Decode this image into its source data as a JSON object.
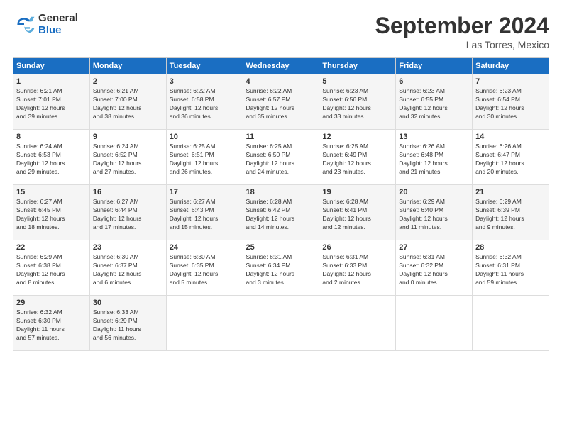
{
  "logo": {
    "general": "General",
    "blue": "Blue"
  },
  "header": {
    "title": "September 2024",
    "location": "Las Torres, Mexico"
  },
  "weekdays": [
    "Sunday",
    "Monday",
    "Tuesday",
    "Wednesday",
    "Thursday",
    "Friday",
    "Saturday"
  ],
  "weeks": [
    [
      {
        "day": "1",
        "lines": [
          "Sunrise: 6:21 AM",
          "Sunset: 7:01 PM",
          "Daylight: 12 hours",
          "and 39 minutes."
        ]
      },
      {
        "day": "2",
        "lines": [
          "Sunrise: 6:21 AM",
          "Sunset: 7:00 PM",
          "Daylight: 12 hours",
          "and 38 minutes."
        ]
      },
      {
        "day": "3",
        "lines": [
          "Sunrise: 6:22 AM",
          "Sunset: 6:58 PM",
          "Daylight: 12 hours",
          "and 36 minutes."
        ]
      },
      {
        "day": "4",
        "lines": [
          "Sunrise: 6:22 AM",
          "Sunset: 6:57 PM",
          "Daylight: 12 hours",
          "and 35 minutes."
        ]
      },
      {
        "day": "5",
        "lines": [
          "Sunrise: 6:23 AM",
          "Sunset: 6:56 PM",
          "Daylight: 12 hours",
          "and 33 minutes."
        ]
      },
      {
        "day": "6",
        "lines": [
          "Sunrise: 6:23 AM",
          "Sunset: 6:55 PM",
          "Daylight: 12 hours",
          "and 32 minutes."
        ]
      },
      {
        "day": "7",
        "lines": [
          "Sunrise: 6:23 AM",
          "Sunset: 6:54 PM",
          "Daylight: 12 hours",
          "and 30 minutes."
        ]
      }
    ],
    [
      {
        "day": "8",
        "lines": [
          "Sunrise: 6:24 AM",
          "Sunset: 6:53 PM",
          "Daylight: 12 hours",
          "and 29 minutes."
        ]
      },
      {
        "day": "9",
        "lines": [
          "Sunrise: 6:24 AM",
          "Sunset: 6:52 PM",
          "Daylight: 12 hours",
          "and 27 minutes."
        ]
      },
      {
        "day": "10",
        "lines": [
          "Sunrise: 6:25 AM",
          "Sunset: 6:51 PM",
          "Daylight: 12 hours",
          "and 26 minutes."
        ]
      },
      {
        "day": "11",
        "lines": [
          "Sunrise: 6:25 AM",
          "Sunset: 6:50 PM",
          "Daylight: 12 hours",
          "and 24 minutes."
        ]
      },
      {
        "day": "12",
        "lines": [
          "Sunrise: 6:25 AM",
          "Sunset: 6:49 PM",
          "Daylight: 12 hours",
          "and 23 minutes."
        ]
      },
      {
        "day": "13",
        "lines": [
          "Sunrise: 6:26 AM",
          "Sunset: 6:48 PM",
          "Daylight: 12 hours",
          "and 21 minutes."
        ]
      },
      {
        "day": "14",
        "lines": [
          "Sunrise: 6:26 AM",
          "Sunset: 6:47 PM",
          "Daylight: 12 hours",
          "and 20 minutes."
        ]
      }
    ],
    [
      {
        "day": "15",
        "lines": [
          "Sunrise: 6:27 AM",
          "Sunset: 6:45 PM",
          "Daylight: 12 hours",
          "and 18 minutes."
        ]
      },
      {
        "day": "16",
        "lines": [
          "Sunrise: 6:27 AM",
          "Sunset: 6:44 PM",
          "Daylight: 12 hours",
          "and 17 minutes."
        ]
      },
      {
        "day": "17",
        "lines": [
          "Sunrise: 6:27 AM",
          "Sunset: 6:43 PM",
          "Daylight: 12 hours",
          "and 15 minutes."
        ]
      },
      {
        "day": "18",
        "lines": [
          "Sunrise: 6:28 AM",
          "Sunset: 6:42 PM",
          "Daylight: 12 hours",
          "and 14 minutes."
        ]
      },
      {
        "day": "19",
        "lines": [
          "Sunrise: 6:28 AM",
          "Sunset: 6:41 PM",
          "Daylight: 12 hours",
          "and 12 minutes."
        ]
      },
      {
        "day": "20",
        "lines": [
          "Sunrise: 6:29 AM",
          "Sunset: 6:40 PM",
          "Daylight: 12 hours",
          "and 11 minutes."
        ]
      },
      {
        "day": "21",
        "lines": [
          "Sunrise: 6:29 AM",
          "Sunset: 6:39 PM",
          "Daylight: 12 hours",
          "and 9 minutes."
        ]
      }
    ],
    [
      {
        "day": "22",
        "lines": [
          "Sunrise: 6:29 AM",
          "Sunset: 6:38 PM",
          "Daylight: 12 hours",
          "and 8 minutes."
        ]
      },
      {
        "day": "23",
        "lines": [
          "Sunrise: 6:30 AM",
          "Sunset: 6:37 PM",
          "Daylight: 12 hours",
          "and 6 minutes."
        ]
      },
      {
        "day": "24",
        "lines": [
          "Sunrise: 6:30 AM",
          "Sunset: 6:35 PM",
          "Daylight: 12 hours",
          "and 5 minutes."
        ]
      },
      {
        "day": "25",
        "lines": [
          "Sunrise: 6:31 AM",
          "Sunset: 6:34 PM",
          "Daylight: 12 hours",
          "and 3 minutes."
        ]
      },
      {
        "day": "26",
        "lines": [
          "Sunrise: 6:31 AM",
          "Sunset: 6:33 PM",
          "Daylight: 12 hours",
          "and 2 minutes."
        ]
      },
      {
        "day": "27",
        "lines": [
          "Sunrise: 6:31 AM",
          "Sunset: 6:32 PM",
          "Daylight: 12 hours",
          "and 0 minutes."
        ]
      },
      {
        "day": "28",
        "lines": [
          "Sunrise: 6:32 AM",
          "Sunset: 6:31 PM",
          "Daylight: 11 hours",
          "and 59 minutes."
        ]
      }
    ],
    [
      {
        "day": "29",
        "lines": [
          "Sunrise: 6:32 AM",
          "Sunset: 6:30 PM",
          "Daylight: 11 hours",
          "and 57 minutes."
        ]
      },
      {
        "day": "30",
        "lines": [
          "Sunrise: 6:33 AM",
          "Sunset: 6:29 PM",
          "Daylight: 11 hours",
          "and 56 minutes."
        ]
      },
      null,
      null,
      null,
      null,
      null
    ]
  ]
}
